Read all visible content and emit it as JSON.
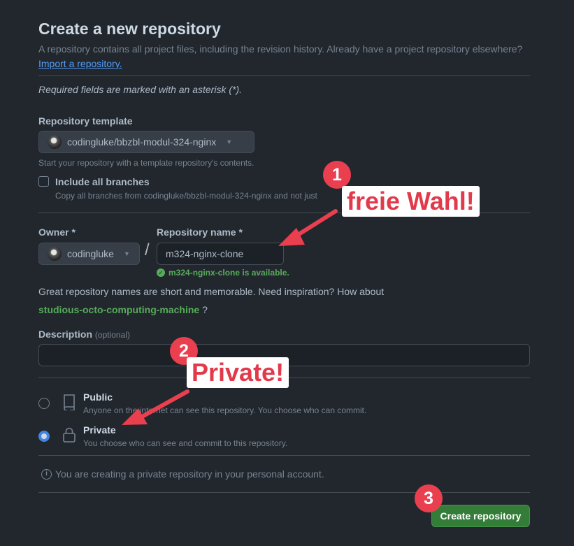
{
  "header": {
    "title": "Create a new repository",
    "intro_text": "A repository contains all project files, including the revision history. Already have a project repository elsewhere?",
    "import_link": "Import a repository."
  },
  "required_note": "Required fields are marked with an asterisk (*).",
  "template": {
    "label": "Repository template",
    "selected": "codingluke/bbzbl-modul-324-nginx",
    "hint": "Start your repository with a template repository's contents.",
    "include_branches_label": "Include all branches",
    "include_branches_hint": "Copy all branches from codingluke/bbzbl-modul-324-nginx and not just"
  },
  "owner": {
    "label": "Owner *",
    "selected": "codingluke"
  },
  "slash": "/",
  "repo_name": {
    "label": "Repository name *",
    "value": "m324-nginx-clone",
    "availability": "m324-nginx-clone is available."
  },
  "inspiration": {
    "text": "Great repository names are short and memorable. Need inspiration? How about",
    "suggestion": "studious-octo-computing-machine",
    "suffix": " ?"
  },
  "description": {
    "label": "Description",
    "optional": "(optional)",
    "value": ""
  },
  "visibility": {
    "public_title": "Public",
    "public_desc": "Anyone on the internet can see this repository. You choose who can commit.",
    "private_title": "Private",
    "private_desc": "You choose who can see and commit to this repository.",
    "selected": "private"
  },
  "info_text": "You are creating a private repository in your personal account.",
  "create_button": "Create repository",
  "annotations": {
    "badge1": "1",
    "callout1": "freie Wahl!",
    "badge2": "2",
    "callout2": "Private!",
    "badge3": "3",
    "color": "#ea3f4f"
  },
  "colors": {
    "background": "#22272e",
    "accent_green": "#347d39",
    "link_blue": "#539bf5",
    "success_green": "#57ab5a"
  }
}
